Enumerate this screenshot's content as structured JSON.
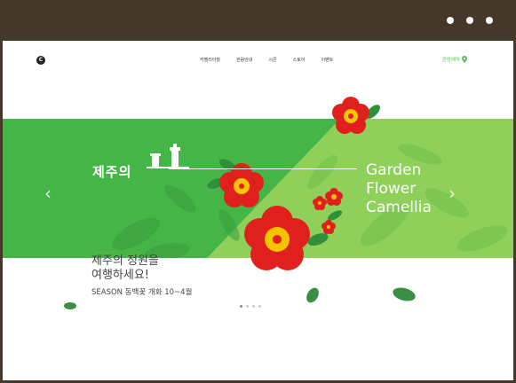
{
  "nav": {
    "logo_letter": "C",
    "menu": [
      "카멜리아힐",
      "관람안내",
      "시즌",
      "스토어",
      "이벤트"
    ],
    "reserve_label": "관람예약"
  },
  "hero": {
    "ko_title": "제주의",
    "en_title": [
      "Garden",
      "Flower",
      "Camellia"
    ],
    "prev_arrow": "‹",
    "next_arrow": "›",
    "accent_color": "#45b548",
    "flower_color": "#e0201c"
  },
  "subtitle": {
    "line1": "제주의 정원을",
    "line2": "여행하세요!",
    "line3": "SEASON 동백꽃 개화 10~4월"
  },
  "pager": {
    "count": 4,
    "active": 0
  }
}
